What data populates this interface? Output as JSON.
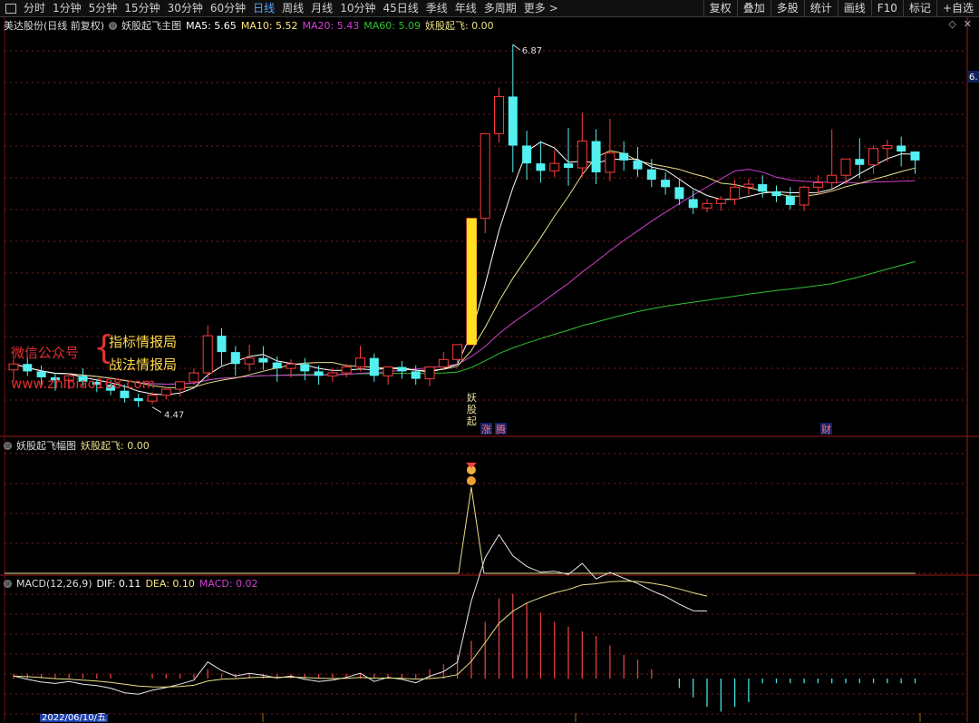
{
  "toolbar": {
    "periods": [
      "分时",
      "1分钟",
      "5分钟",
      "15分钟",
      "30分钟",
      "60分钟",
      "日线",
      "周线",
      "月线",
      "10分钟",
      "45日线",
      "季线",
      "年线",
      "多周期",
      "更多 >"
    ],
    "active_period": "日线",
    "right_buttons": [
      "复权",
      "叠加",
      "多股",
      "统计",
      "画线",
      "F10",
      "标记",
      "+自选"
    ]
  },
  "main_pane": {
    "stock_name": "美达股份(日线 前复权)",
    "indicator_name": "妖股起飞主图",
    "ma5": "MA5: 5.65",
    "ma10": "MA10: 5.52",
    "ma20": "MA20: 5.43",
    "ma60": "MA60: 5.09",
    "signal": "妖股起飞: 0.00",
    "high_label": "6.87",
    "low_label": "4.47",
    "axis_tag": "6.",
    "signal_text": "妖股起",
    "event_marks": [
      "涨",
      "腾",
      "财"
    ],
    "icons": [
      "window-restore-icon",
      "close-icon"
    ]
  },
  "promo": {
    "wechat": "微信公众号",
    "line1": "指标情报局",
    "line2": "战法情报局",
    "url": "www.zhibiao168.com"
  },
  "sub_pane1": {
    "title": "妖股起飞幅图",
    "value": "妖股起飞: 0.00"
  },
  "sub_pane2": {
    "name": "MACD(12,26,9)",
    "dif": "DIF: 0.11",
    "dea": "DEA: 0.10",
    "macd": "MACD: 0.02"
  },
  "date_label": "2022/06/10/五",
  "colors": {
    "up": "#ff3c3c",
    "down": "#54f0f0",
    "ma5": "#ffffff",
    "ma10": "#e8e08a",
    "ma20": "#d040d0",
    "ma60": "#30c030",
    "grid": "#8a1a1a",
    "signal_bar": "#ffe020",
    "active_tab": "#55a7ff"
  },
  "chart_data": {
    "type": "candlestick",
    "candles": [
      [
        4.68,
        4.75,
        4.72,
        4.6
      ],
      [
        4.72,
        4.77,
        4.67,
        4.64
      ],
      [
        4.67,
        4.71,
        4.63,
        4.58
      ],
      [
        4.63,
        4.66,
        4.61,
        4.54
      ],
      [
        4.61,
        4.66,
        4.64,
        4.55
      ],
      [
        4.64,
        4.69,
        4.6,
        4.57
      ],
      [
        4.6,
        4.62,
        4.58,
        4.53
      ],
      [
        4.58,
        4.61,
        4.54,
        4.51
      ],
      [
        4.54,
        4.58,
        4.49,
        4.46
      ],
      [
        4.49,
        4.52,
        4.47,
        4.43
      ],
      [
        4.47,
        4.53,
        4.51,
        4.45
      ],
      [
        4.51,
        4.54,
        4.55,
        4.48
      ],
      [
        4.55,
        4.58,
        4.6,
        4.5
      ],
      [
        4.6,
        4.69,
        4.66,
        4.58
      ],
      [
        4.66,
        4.98,
        4.91,
        4.62
      ],
      [
        4.91,
        4.96,
        4.8,
        4.71
      ],
      [
        4.8,
        4.84,
        4.72,
        4.64
      ],
      [
        4.72,
        4.85,
        4.76,
        4.67
      ],
      [
        4.76,
        4.84,
        4.73,
        4.68
      ],
      [
        4.73,
        4.77,
        4.69,
        4.6
      ],
      [
        4.69,
        4.75,
        4.72,
        4.63
      ],
      [
        4.72,
        4.76,
        4.67,
        4.61
      ],
      [
        4.67,
        4.71,
        4.64,
        4.58
      ],
      [
        4.64,
        4.69,
        4.66,
        4.6
      ],
      [
        4.66,
        4.72,
        4.7,
        4.63
      ],
      [
        4.7,
        4.84,
        4.76,
        4.67
      ],
      [
        4.76,
        4.79,
        4.64,
        4.6
      ],
      [
        4.64,
        4.69,
        4.7,
        4.58
      ],
      [
        4.7,
        4.74,
        4.67,
        4.62
      ],
      [
        4.67,
        4.71,
        4.62,
        4.58
      ],
      [
        4.62,
        4.69,
        4.7,
        4.57
      ],
      [
        4.7,
        4.8,
        4.75,
        4.68
      ],
      [
        4.75,
        4.82,
        4.85,
        4.72
      ],
      [
        4.85,
        5.7,
        5.7,
        4.85
      ],
      [
        5.7,
        6.14,
        6.27,
        5.6
      ],
      [
        6.27,
        6.58,
        6.52,
        6.21
      ],
      [
        6.52,
        6.87,
        6.19,
        6.01
      ],
      [
        6.19,
        6.29,
        6.07,
        5.96
      ],
      [
        6.07,
        6.22,
        6.02,
        5.94
      ],
      [
        6.02,
        6.16,
        6.07,
        5.98
      ],
      [
        6.07,
        6.31,
        6.04,
        5.92
      ],
      [
        6.04,
        6.41,
        6.22,
        5.98
      ],
      [
        6.22,
        6.3,
        6.01,
        5.93
      ],
      [
        6.01,
        6.37,
        6.14,
        5.95
      ],
      [
        6.14,
        6.22,
        6.09,
        6.02
      ],
      [
        6.09,
        6.18,
        6.03,
        5.98
      ],
      [
        6.03,
        6.1,
        5.96,
        5.91
      ],
      [
        5.96,
        6.01,
        5.91,
        5.86
      ],
      [
        5.91,
        5.96,
        5.83,
        5.79
      ],
      [
        5.83,
        5.89,
        5.77,
        5.73
      ],
      [
        5.77,
        5.83,
        5.8,
        5.74
      ],
      [
        5.8,
        5.85,
        5.83,
        5.75
      ],
      [
        5.83,
        5.96,
        5.91,
        5.79
      ],
      [
        5.91,
        5.97,
        5.93,
        5.86
      ],
      [
        5.93,
        5.99,
        5.88,
        5.84
      ],
      [
        5.88,
        5.92,
        5.85,
        5.81
      ],
      [
        5.85,
        5.91,
        5.79,
        5.76
      ],
      [
        5.79,
        5.92,
        5.91,
        5.75
      ],
      [
        5.91,
        5.99,
        5.94,
        5.86
      ],
      [
        5.94,
        6.3,
        5.99,
        5.9
      ],
      [
        5.99,
        6.07,
        6.1,
        5.93
      ],
      [
        6.1,
        6.24,
        6.06,
        5.97
      ],
      [
        6.06,
        6.19,
        6.17,
        6.0
      ],
      [
        6.17,
        6.23,
        6.19,
        6.08
      ],
      [
        6.19,
        6.25,
        6.15,
        6.05
      ],
      [
        6.15,
        6.14,
        6.09,
        6.0
      ]
    ],
    "macd_hist": [
      0.01,
      0.01,
      0.01,
      0.01,
      0.01,
      0.01,
      0.01,
      0.01,
      0.0,
      0.0,
      0.01,
      0.01,
      0.01,
      0.01,
      0.02,
      0.01,
      0.01,
      0.01,
      0.01,
      0.01,
      0.01,
      0.01,
      0.01,
      0.01,
      0.01,
      0.01,
      0.01,
      0.01,
      0.01,
      0.01,
      0.02,
      0.03,
      0.05,
      0.08,
      0.12,
      0.17,
      0.18,
      0.16,
      0.14,
      0.12,
      0.11,
      0.1,
      0.09,
      0.07,
      0.05,
      0.04,
      0.02,
      0.0,
      -0.02,
      -0.04,
      -0.06,
      -0.07,
      -0.06,
      -0.05,
      -0.01,
      -0.01,
      -0.01,
      -0.01,
      -0.01,
      -0.01,
      -0.01,
      -0.01,
      -0.01,
      -0.01,
      -0.01,
      -0.01
    ],
    "signal_index": 33
  }
}
